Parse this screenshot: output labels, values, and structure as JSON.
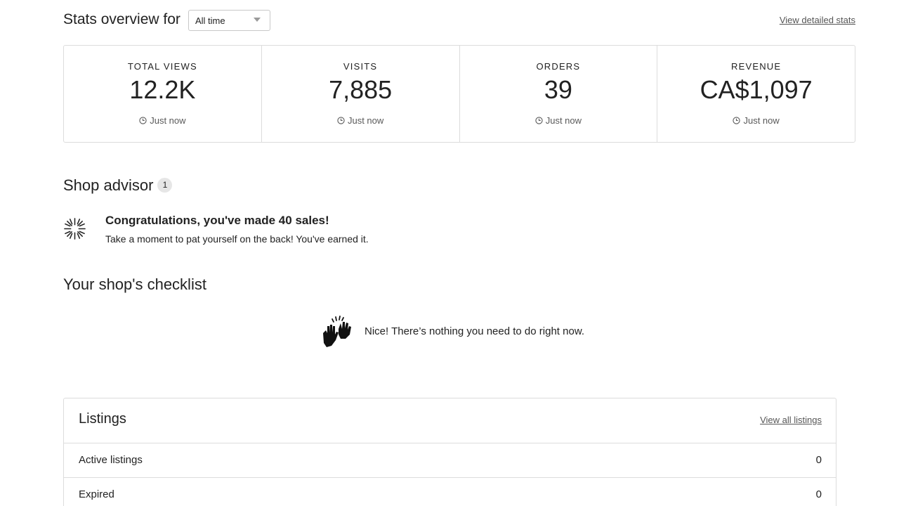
{
  "stats": {
    "title": "Stats overview for",
    "period": "All time",
    "detailed_link": "View detailed stats",
    "cards": [
      {
        "label": "TOTAL VIEWS",
        "value": "12.2K",
        "updated": "Just now"
      },
      {
        "label": "VISITS",
        "value": "7,885",
        "updated": "Just now"
      },
      {
        "label": "ORDERS",
        "value": "39",
        "updated": "Just now"
      },
      {
        "label": "REVENUE",
        "value": "CA$1,097",
        "updated": "Just now"
      }
    ]
  },
  "advisor": {
    "title": "Shop advisor",
    "badge_count": "1",
    "items": [
      {
        "icon": "celebration-burst-icon",
        "heading": "Congratulations, you've made 40 sales!",
        "description": "Take a moment to pat yourself on the back! You've earned it."
      }
    ]
  },
  "checklist": {
    "title": "Your shop's checklist",
    "icon": "clapping-hands-icon",
    "empty_message": "Nice! There’s nothing you need to do right now."
  },
  "listings": {
    "title": "Listings",
    "view_all": "View all listings",
    "rows": [
      {
        "label": "Active listings",
        "count": "0"
      },
      {
        "label": "Expired",
        "count": "0"
      }
    ]
  }
}
